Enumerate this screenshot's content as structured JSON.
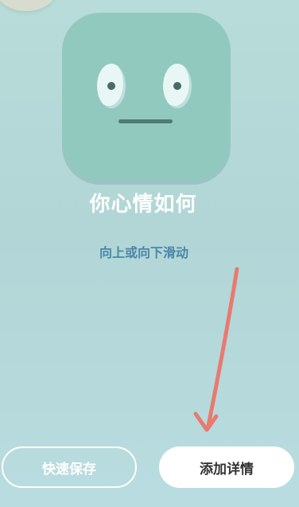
{
  "mood": {
    "title": "你心情如何",
    "hint": "向上或向下滑动",
    "face_icon": "neutral-face-icon"
  },
  "actions": {
    "quick_save_label": "快速保存",
    "add_details_label": "添加详情"
  },
  "colors": {
    "background": "#b5d9d8",
    "face": "#92c9be",
    "hint_text": "#4a86a8",
    "annotation_arrow": "#e87a70"
  }
}
